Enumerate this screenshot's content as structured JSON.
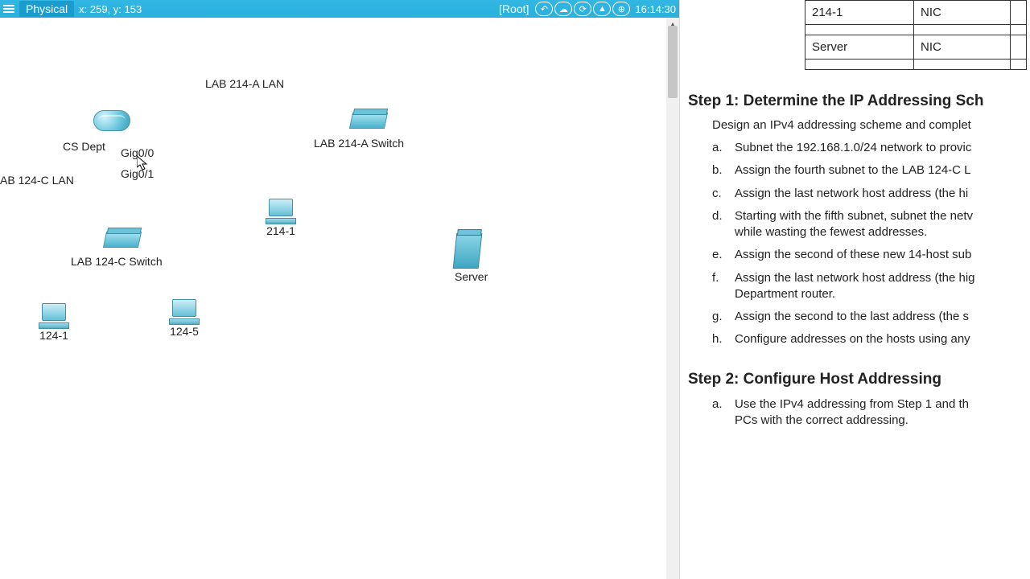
{
  "toolbar": {
    "tab": "Physical",
    "coords": "x: 259, y: 153",
    "root": "[Root]",
    "clock": "16:14:30"
  },
  "topology": {
    "lan214": "LAB 214-A LAN",
    "lan124": "AB 124-C LAN",
    "router": "CS Dept",
    "gig00": "Gig0/0",
    "gig01": "Gig0/1",
    "sw214": "LAB 214-A Switch",
    "sw124": "LAB 124-C Switch",
    "pc214": "214-1",
    "server": "Server",
    "pc124a": "124-1",
    "pc124b": "124-5"
  },
  "table": {
    "r1c1": "214-1",
    "r1c2": "NIC",
    "r2c1": "Server",
    "r2c2": "NIC"
  },
  "doc": {
    "step1_title": "Step 1: Determine the IP Addressing Sch",
    "step1_lead": "Design an IPv4 addressing scheme and complet",
    "a": "Subnet the 192.168.1.0/24 network to provic",
    "b": "Assign the fourth subnet to the LAB 124-C L",
    "c": "Assign the last network host address (the hi",
    "d1": "Starting with the fifth subnet, subnet the netv",
    "d2": "while wasting the fewest addresses.",
    "e": "Assign the second of these new 14-host sub",
    "f1": "Assign the last network host address (the hig",
    "f2": "Department router.",
    "g": "Assign the second to the last address (the s",
    "h": "Configure addresses on the hosts using any",
    "step2_title": "Step 2: Configure Host Addressing",
    "s2a1": "Use the IPv4 addressing from Step 1 and th",
    "s2a2": "PCs with the correct addressing."
  }
}
